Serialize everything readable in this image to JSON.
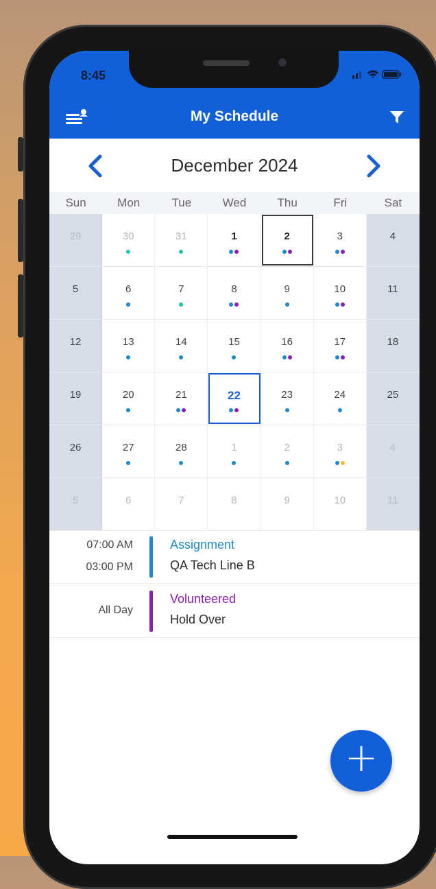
{
  "status": {
    "time": "8:45",
    "icons": "signal-icon wifi-icon battery-icon"
  },
  "appbar": {
    "title": "My Schedule",
    "menu_icon": "menu-person-icon",
    "filter_icon": "filter-icon"
  },
  "month_nav": {
    "label": "December 2024",
    "prev_icon": "chevron-left-icon",
    "next_icon": "chevron-right-icon"
  },
  "colors": {
    "primary": "#1260d9",
    "assignment": "#1e88c9",
    "volunteered": "#8a1fb0",
    "dot_blue": "#1e88c9",
    "dot_teal": "#22c3a6",
    "dot_purple": "#8a1fb0",
    "dot_yellow": "#f2c021"
  },
  "weekdays": [
    "Sun",
    "Mon",
    "Tue",
    "Wed",
    "Thu",
    "Fri",
    "Sat"
  ],
  "calendar": [
    [
      {
        "d": "29",
        "outside": true,
        "dots": []
      },
      {
        "d": "30",
        "outside": true,
        "dots": [
          "teal"
        ]
      },
      {
        "d": "31",
        "outside": true,
        "dots": [
          "teal"
        ]
      },
      {
        "d": "1",
        "bold": true,
        "dots": [
          "blue",
          "purple"
        ]
      },
      {
        "d": "2",
        "bold": true,
        "selected": true,
        "dots": [
          "blue",
          "purple"
        ]
      },
      {
        "d": "3",
        "dots": [
          "blue",
          "purple"
        ]
      },
      {
        "d": "4",
        "dots": []
      }
    ],
    [
      {
        "d": "5",
        "dots": []
      },
      {
        "d": "6",
        "dots": [
          "blue"
        ]
      },
      {
        "d": "7",
        "dots": [
          "teal"
        ]
      },
      {
        "d": "8",
        "dots": [
          "blue",
          "purple"
        ]
      },
      {
        "d": "9",
        "dots": [
          "blue"
        ]
      },
      {
        "d": "10",
        "dots": [
          "blue",
          "purple"
        ]
      },
      {
        "d": "11",
        "dots": []
      }
    ],
    [
      {
        "d": "12",
        "dots": []
      },
      {
        "d": "13",
        "dots": [
          "blue"
        ]
      },
      {
        "d": "14",
        "dots": [
          "blue"
        ]
      },
      {
        "d": "15",
        "dots": [
          "blue"
        ]
      },
      {
        "d": "16",
        "dots": [
          "blue",
          "purple"
        ]
      },
      {
        "d": "17",
        "dots": [
          "blue",
          "purple"
        ]
      },
      {
        "d": "18",
        "dots": []
      }
    ],
    [
      {
        "d": "19",
        "dots": []
      },
      {
        "d": "20",
        "dots": [
          "blue"
        ]
      },
      {
        "d": "21",
        "dots": [
          "blue",
          "purple"
        ]
      },
      {
        "d": "22",
        "today": true,
        "dots": [
          "blue",
          "purple"
        ]
      },
      {
        "d": "23",
        "dots": [
          "blue"
        ]
      },
      {
        "d": "24",
        "dots": [
          "blue"
        ]
      },
      {
        "d": "25",
        "dots": []
      }
    ],
    [
      {
        "d": "26",
        "dots": []
      },
      {
        "d": "27",
        "dots": [
          "blue"
        ]
      },
      {
        "d": "28",
        "dots": [
          "blue"
        ]
      },
      {
        "d": "1",
        "outside": true,
        "dots": [
          "blue"
        ]
      },
      {
        "d": "2",
        "outside": true,
        "dots": [
          "blue"
        ]
      },
      {
        "d": "3",
        "outside": true,
        "dots": [
          "blue",
          "yellow"
        ]
      },
      {
        "d": "4",
        "outside": true,
        "dots": []
      }
    ],
    [
      {
        "d": "5",
        "outside": true,
        "dots": []
      },
      {
        "d": "6",
        "outside": true,
        "dots": []
      },
      {
        "d": "7",
        "outside": true,
        "dots": []
      },
      {
        "d": "8",
        "outside": true,
        "dots": []
      },
      {
        "d": "9",
        "outside": true,
        "dots": []
      },
      {
        "d": "10",
        "outside": true,
        "dots": []
      },
      {
        "d": "11",
        "outside": true,
        "dots": []
      }
    ]
  ],
  "events": [
    {
      "start": "07:00 AM",
      "end": "03:00 PM",
      "category": "Assignment",
      "name": "QA Tech Line B",
      "color": "#1e88c9"
    },
    {
      "start": "All Day",
      "end": "",
      "category": "Volunteered",
      "name": "Hold Over",
      "color": "#8a1fb0"
    }
  ],
  "fab": {
    "label": "+",
    "icon": "plus-icon"
  }
}
